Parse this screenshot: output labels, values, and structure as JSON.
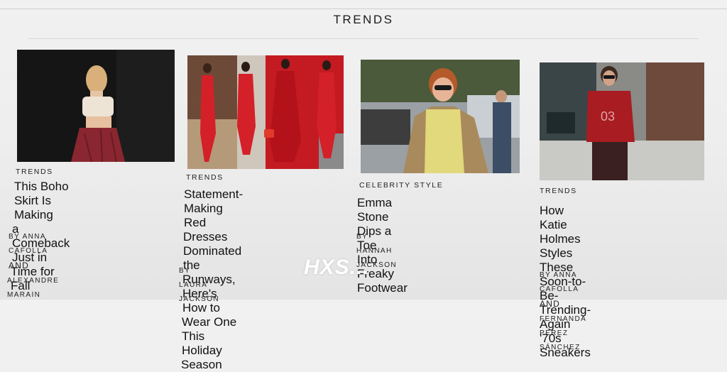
{
  "section": {
    "title": "TRENDS"
  },
  "cards": [
    {
      "category": "TRENDS",
      "headline": [
        "This Boho Skirt Is Making",
        "a Comeback Just in",
        "Time for Fall"
      ],
      "byline": {
        "prefix": "BY ANNA CAFOLLA",
        "and": "AND",
        "second": "ALEXANDRE MARAIN"
      }
    },
    {
      "category": "TRENDS",
      "headline": [
        "Statement-Making Red",
        "Dresses Dominated the",
        "Runways, Here's How to",
        "Wear One This Holiday",
        "Season"
      ],
      "byline": {
        "prefix": "BY LAURA JACKSON"
      }
    },
    {
      "category": "CELEBRITY STYLE",
      "headline": [
        "Emma Stone Dips a Toe",
        "Into Freaky Footwear"
      ],
      "byline": {
        "prefix": "BY HANNAH JACKSON"
      }
    },
    {
      "category": "TRENDS",
      "headline": [
        "How Katie Holmes Styles",
        "These Soon-to-Be-",
        "Trending-Again '70s",
        "Sneakers"
      ],
      "byline": {
        "prefix": "BY ANNA CAFOLLA",
        "and": "AND",
        "second": "FERNANDA PÉREZ SÁNCHEZ"
      }
    }
  ],
  "watermark": "HXS...",
  "colors": {
    "accent_red": "#c8141c",
    "page_bg": "#eeeeee",
    "text": "#141414"
  }
}
